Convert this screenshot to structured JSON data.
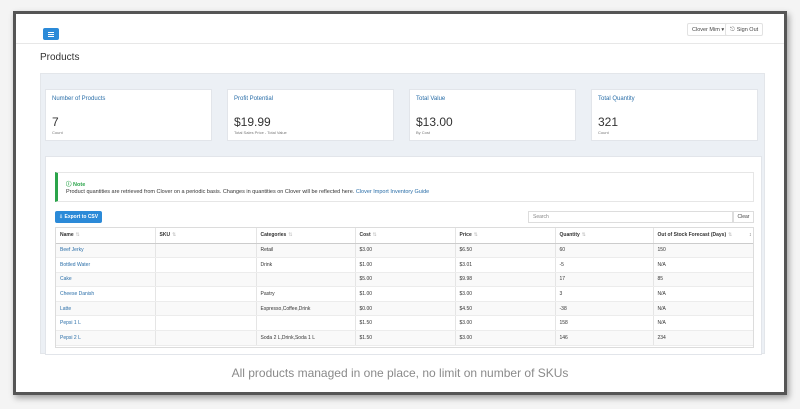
{
  "topbar": {
    "user_label": "Clover Mim ▾",
    "signout_label": "Sign Out"
  },
  "page_title": "Products",
  "cards": [
    {
      "label": "Number of Products",
      "value": "7",
      "sub": "Count"
    },
    {
      "label": "Profit Potential",
      "value": "$19.99",
      "sub": "Total Sales Price - Total Value"
    },
    {
      "label": "Total Value",
      "value": "$13.00",
      "sub": "By Cost"
    },
    {
      "label": "Total Quantity",
      "value": "321",
      "sub": "Count"
    }
  ],
  "note": {
    "heading": "Note",
    "body": "Product quantities are retrieved from Clover on a periodic basis. Changes in quantities on Clover will be reflected here.",
    "link": "Clover Import Inventory Guide"
  },
  "toolbar": {
    "export_label": "Export to CSV",
    "search_placeholder": "Search",
    "clear_label": "Clear"
  },
  "table": {
    "columns": [
      "Name",
      "SKU",
      "Categories",
      "Cost",
      "Price",
      "Quantity",
      "Out of Stock Forecast (Days)"
    ],
    "rows": [
      [
        "Beef Jerky",
        "",
        "Retail",
        "$3.00",
        "$6.50",
        "60",
        "150"
      ],
      [
        "Bottled Water",
        "",
        "Drink",
        "$1.00",
        "$3.01",
        "-5",
        "N/A"
      ],
      [
        "Cake",
        "",
        "",
        "$5.00",
        "$9.98",
        "17",
        "85"
      ],
      [
        "Cheese Danish",
        "",
        "Pastry",
        "$1.00",
        "$3.00",
        "3",
        "N/A"
      ],
      [
        "Latte",
        "",
        "Espresso,Coffee,Drink",
        "$0.00",
        "$4.50",
        "-38",
        "N/A"
      ],
      [
        "Pepsi 1 L",
        "",
        "",
        "$1.50",
        "$3.00",
        "158",
        "N/A"
      ],
      [
        "Pepsi 2 L",
        "",
        "Soda 2 L,Drink,Soda 1 L",
        "$1.50",
        "$3.00",
        "146",
        "234"
      ]
    ]
  },
  "caption": "All products managed in one place, no limit on number of SKUs"
}
